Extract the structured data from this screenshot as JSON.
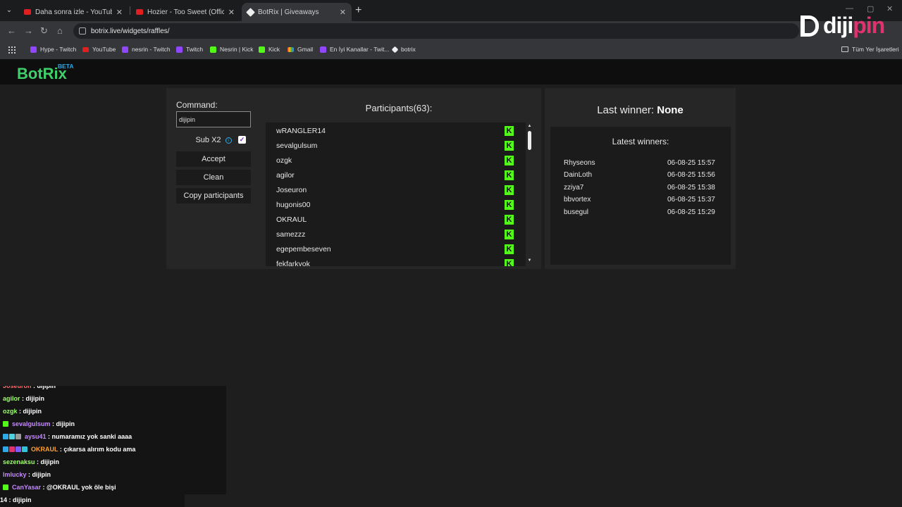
{
  "browser": {
    "tabs": [
      {
        "label": "Daha sonra izle - YouTube",
        "close": "✕"
      },
      {
        "label": "Hozier - Too Sweet (Official Lyric",
        "close": "✕"
      },
      {
        "label": "BotRix | Giveaways",
        "close": "✕"
      }
    ],
    "new_tab": "+",
    "url": "botrix.live/widgets/raffles/",
    "bookmarks": [
      "Hype - Twitch",
      "YouTube",
      "nesrin - Twitch",
      "Twitch",
      "Nesrin | Kick",
      "Kick",
      "Gmail",
      "En İyi Kanallar - Twit...",
      "botrix"
    ],
    "all_bookmarks": "Tüm Yer İşaretleri"
  },
  "watermark": {
    "part1": "diji",
    "part2": "pin"
  },
  "app": {
    "logo": "BotRix",
    "beta": "BETA"
  },
  "controls": {
    "command_label": "Command:",
    "command_value": "dijipin",
    "sub_label": "Sub X2",
    "info_icon": "i",
    "checkmark": "✓",
    "accept": "Accept",
    "clean": "Clean",
    "copy": "Copy participants"
  },
  "participants": {
    "title": "Participants(63):",
    "kick_glyph": "K",
    "list": [
      "wRANGLER14",
      "sevalgulsum",
      "ozgk",
      "agilor",
      "Joseuron",
      "hugonis00",
      "OKRAUL",
      "samezzz",
      "egepembeseven",
      "fekfarkyok"
    ]
  },
  "winners": {
    "last_winner_label": "Last winner:",
    "last_winner_value": "None",
    "latest_title": "Latest winners:",
    "list": [
      {
        "name": "Rhyseons",
        "date": "06-08-25 15:57"
      },
      {
        "name": "DainLoth",
        "date": "06-08-25 15:56"
      },
      {
        "name": "zziya7",
        "date": "06-08-25 15:38"
      },
      {
        "name": "bbvortex",
        "date": "06-08-25 15:37"
      },
      {
        "name": "busegul",
        "date": "06-08-25 15:29"
      }
    ]
  },
  "chat": {
    "lines": [
      {
        "user": "Joseuron",
        "msg": "dijipin",
        "color": "#ff6b6b",
        "badges": []
      },
      {
        "user": "agilor",
        "msg": "dijipin",
        "color": "#9eff6b",
        "badges": []
      },
      {
        "user": "ozgk",
        "msg": "dijipin",
        "color": "#9eff6b",
        "badges": []
      },
      {
        "user": "sevalgulsum",
        "msg": "dijipin",
        "color": "#c58aff",
        "badges": [
          "#53fc18"
        ]
      },
      {
        "user": "aysu41",
        "msg": "numaramız yok sanki aaaa",
        "color": "#c58aff",
        "badges": [
          "#2fa9e8",
          "#4fd1e0",
          "#9a9a9a"
        ]
      },
      {
        "user": "OKRAUL",
        "msg": "çıkarsa alırım kodu ama",
        "color": "#ffa033",
        "badges": [
          "#2fa9e8",
          "#e0336d",
          "#7b5cff",
          "#31c4d9"
        ]
      },
      {
        "user": "sezenaksu",
        "msg": "dijipin",
        "color": "#9eff6b",
        "badges": []
      },
      {
        "user": "lmlucky",
        "msg": "dijipin",
        "color": "#c58aff",
        "badges": []
      },
      {
        "user": "CanYasar",
        "msg": "@OKRAUL yok öle bişi",
        "color": "#c58aff",
        "badges": [
          "#53fc18"
        ]
      }
    ],
    "bottom_user": "14",
    "bottom_msg": "dijipin"
  },
  "colors": {
    "kick_green": "#53fc18",
    "logo_green": "#3fd06b",
    "beta_blue": "#2fa9e8",
    "brand_pink": "#e0336d"
  }
}
